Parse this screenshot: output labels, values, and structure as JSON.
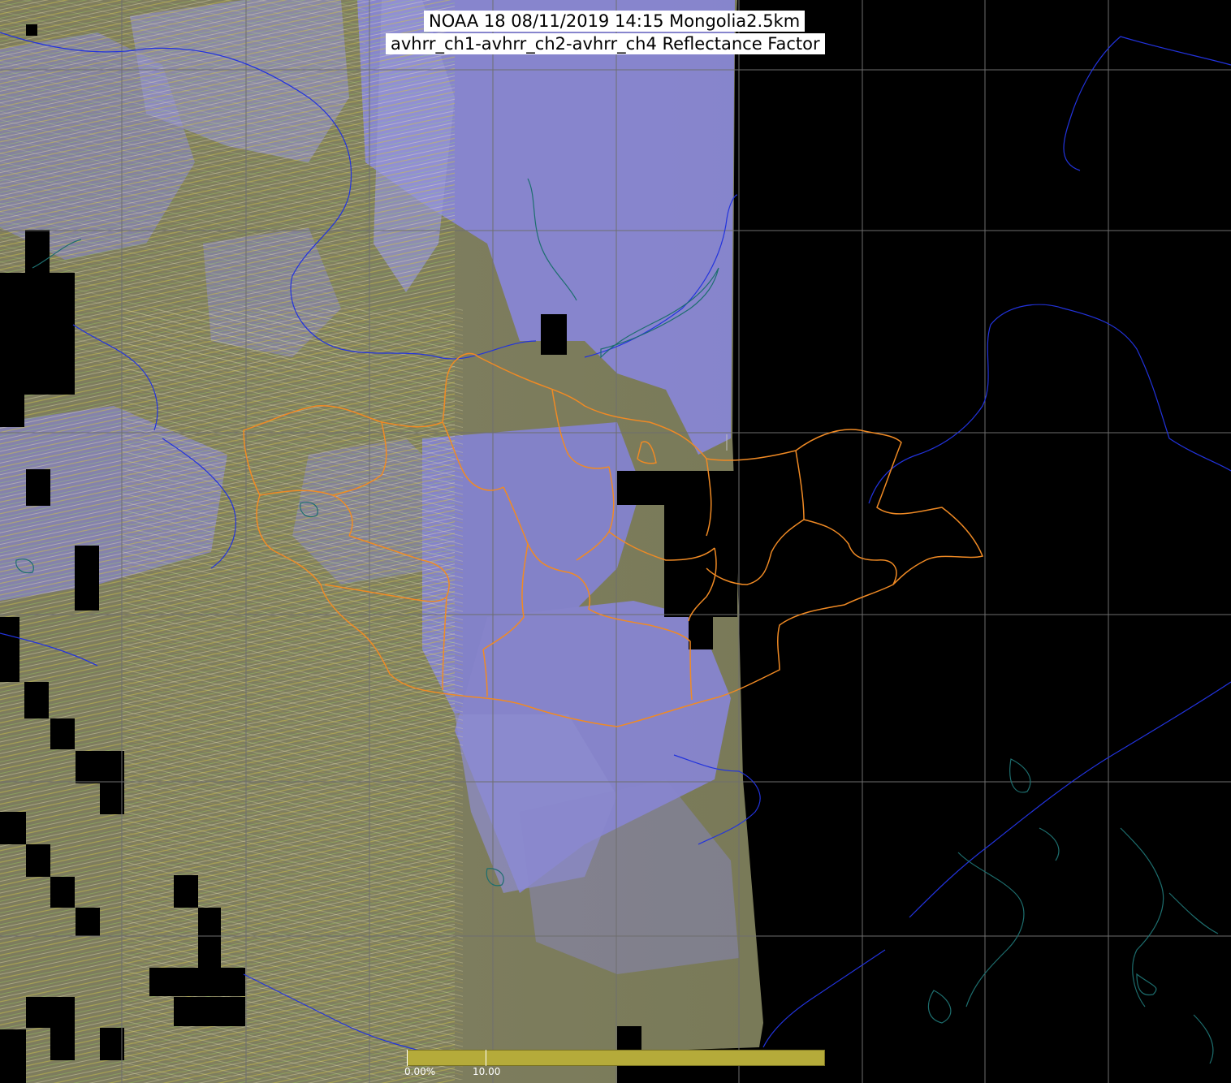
{
  "title": {
    "line1": "NOAA 18 08/11/2019 14:15 Mongolia2.5km",
    "line2": "avhrr_ch1-avhrr_ch2-avhrr_ch4 Reflectance Factor"
  },
  "legend": {
    "min_label": "0.00%",
    "mid_label": "10.00",
    "color": "#b5ab3a"
  },
  "colors": {
    "background": "#000000",
    "land_olive": "#7b7a55",
    "cloud_lavender": "#8a88e6",
    "grid": "#6e6e6e",
    "province_borders": "#f08a24",
    "rivers": "#2233dd",
    "coastlines": "#1d6e6e"
  },
  "layers": [
    "satellite-swath",
    "graticule",
    "province-borders",
    "rivers",
    "coastlines"
  ]
}
